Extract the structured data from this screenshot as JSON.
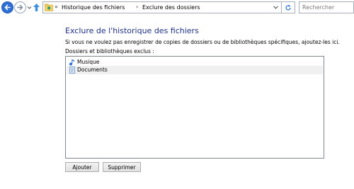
{
  "navigation": {
    "back_icon": "back-arrow-icon",
    "forward_icon": "forward-arrow-icon",
    "up_icon": "up-arrow-icon"
  },
  "address_bar": {
    "overflow_glyph": "«",
    "separator_glyph": "›",
    "crumbs": [
      "Historique des fichiers",
      "Exclure des dossiers"
    ]
  },
  "search": {
    "placeholder": "Rechercher"
  },
  "main": {
    "title": "Exclure de l'historique des fichiers",
    "description": "Si vous ne voulez pas enregistrer de copies de dossiers ou de bibliothèques spécifiques, ajoutez-les ici.",
    "list_label": "Dossiers et bibliothèques exclus :",
    "excluded_items": [
      {
        "label": "Musique",
        "icon": "music-library-icon",
        "selected": false
      },
      {
        "label": "Documents",
        "icon": "documents-library-icon",
        "selected": true
      }
    ]
  },
  "buttons": {
    "add_label": "Ajouter",
    "remove_label": "Supprimer"
  },
  "colors": {
    "title": "#1e3287",
    "back_button": "#2f6fd6",
    "up_arrow": "#3b8ee0"
  }
}
